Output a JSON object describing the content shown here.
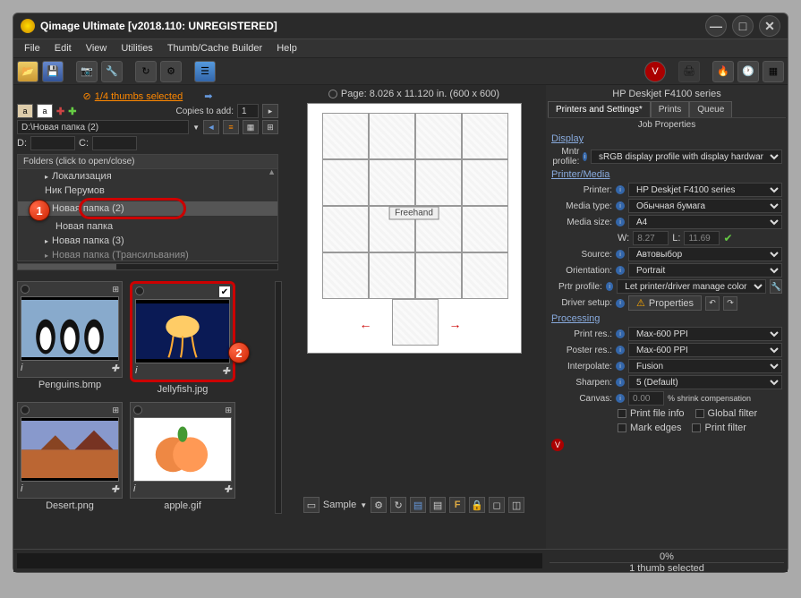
{
  "title": "Qimage Ultimate [v2018.110: UNREGISTERED]",
  "menu": [
    "File",
    "Edit",
    "View",
    "Utilities",
    "Thumb/Cache Builder",
    "Help"
  ],
  "left": {
    "thumbs_selected": "1/4 thumbs selected",
    "copies_label": "Copies to add:",
    "copies_value": "1",
    "path": "D:\\Новая папка (2)",
    "drive_d": "D:",
    "drive_c": "C:",
    "folder_header": "Folders (click to open/close)",
    "folders": [
      {
        "name": "Локализация",
        "arrow": true
      },
      {
        "name": "Ник Перумов"
      },
      {
        "name": "Новая папка (2)",
        "selected": true,
        "arrow": true,
        "circled": true
      },
      {
        "name": "Новая папка"
      },
      {
        "name": "Новая папка (3)",
        "arrow": true
      },
      {
        "name": "Новая папка (Трансильвания)",
        "arrow": true
      }
    ]
  },
  "thumbs": [
    {
      "name": "Penguins.bmp",
      "checked": false
    },
    {
      "name": "Jellyfish.jpg",
      "checked": true,
      "circled": true
    },
    {
      "name": "Desert.png",
      "checked": false
    },
    {
      "name": "apple.gif",
      "checked": false
    }
  ],
  "center": {
    "page_info": "Page: 8.026 x 11.120 in.  (600 x 600)",
    "freehand": "Freehand",
    "sample": "Sample"
  },
  "right": {
    "printer_title": "HP Deskjet F4100 series",
    "tabs": [
      "Printers and Settings*",
      "Prints",
      "Queue"
    ],
    "job_props": "Job Properties",
    "display": "Display",
    "mntr_profile_label": "Mntr profile:",
    "mntr_profile": "sRGB display profile with display hardwar",
    "printer_media": "Printer/Media",
    "printer_label": "Printer:",
    "printer": "HP Deskjet F4100 series",
    "media_type_label": "Media type:",
    "media_type": "Обычная бумага",
    "media_size_label": "Media size:",
    "media_size": "A4",
    "w_label": "W:",
    "w": "8.27",
    "l_label": "L:",
    "l": "11.69",
    "source_label": "Source:",
    "source": "Автовыбор",
    "orientation_label": "Orientation:",
    "orientation": "Portrait",
    "prtr_profile_label": "Prtr profile:",
    "prtr_profile": "Let printer/driver manage color",
    "driver_setup_label": "Driver setup:",
    "properties_btn": "Properties",
    "processing": "Processing",
    "print_res_label": "Print res.:",
    "print_res": "Max-600 PPI",
    "poster_res_label": "Poster res.:",
    "poster_res": "Max-600 PPI",
    "interpolate_label": "Interpolate:",
    "interpolate": "Fusion",
    "sharpen_label": "Sharpen:",
    "sharpen": "5 (Default)",
    "canvas_label": "Canvas:",
    "canvas_val": "0.00",
    "canvas_unit": "% shrink compensation",
    "check1": "Print file info",
    "check2": "Global filter",
    "check3": "Mark edges",
    "check4": "Print filter"
  },
  "status": {
    "percent": "0%",
    "selected": "1 thumb selected"
  },
  "badges": {
    "b1": "1",
    "b2": "2"
  }
}
